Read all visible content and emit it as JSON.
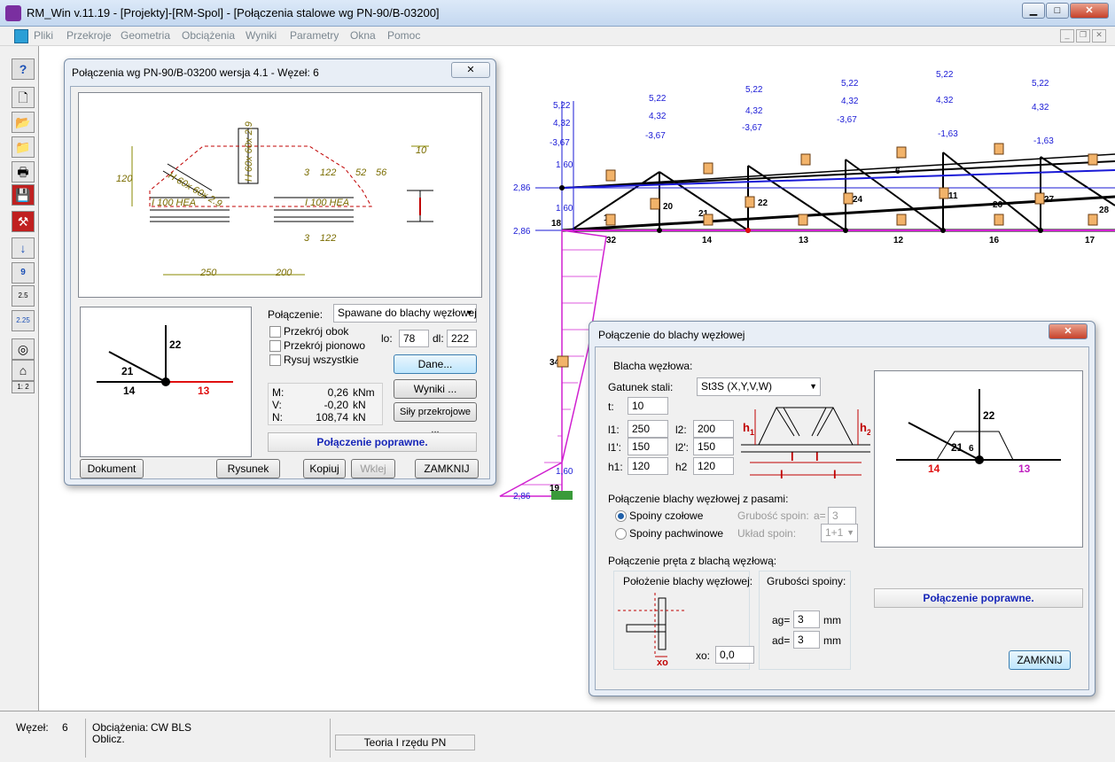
{
  "app": {
    "title": "RM_Win v.11.19 - [Projekty]-[RM-Spol] - [Połączenia stalowe wg PN-90/B-03200]"
  },
  "menu": [
    "Pliki",
    "Przekroje",
    "Geometria",
    "Obciążenia",
    "Wyniki",
    "Parametry",
    "Okna",
    "Pomoc"
  ],
  "toolbar": {
    "label_9": "9",
    "label_25": "2.5",
    "label_225": "2.25",
    "label_scale": "1: 2"
  },
  "dialog1": {
    "title": "Połączenia wg PN-90/B-03200 wersja 4.1 - Węzeł: 6",
    "drawing": {
      "dim_120": "120",
      "dim_10": "10",
      "lbl_h": "H 60x 60x 2.9",
      "lbl_v": "H 60x 60x 2.9",
      "lbl_i1": "I 100 HEA",
      "lbl_i2": "I 100 HEA",
      "w122a": "122",
      "w3a": "3",
      "w56": "56",
      "w52": "52",
      "w122b": "122",
      "w3b": "3",
      "dim250": "250",
      "dim200": "200"
    },
    "node": {
      "n22": "22",
      "n21": "21",
      "n14": "14",
      "n13": "13"
    },
    "polaczenie_label": "Połączenie:",
    "polaczenie_value": "Spawane do blachy węzłowej",
    "cb_obok": "Przekrój obok",
    "cb_pion": "Przekrój pionowo",
    "cb_all": "Rysuj wszystkie",
    "lo_label": "lo:",
    "lo_value": "78",
    "dl_label": "dl:",
    "dl_value": "222",
    "btn_dane": "Dane...",
    "btn_wyniki": "Wyniki ...",
    "btn_sily": "Siły przekrojowe ...",
    "forces": [
      {
        "k": "M:",
        "v": "0,26",
        "u": "kNm"
      },
      {
        "k": "V:",
        "v": "-0,20",
        "u": "kN"
      },
      {
        "k": "N:",
        "v": "108,74",
        "u": "kN"
      }
    ],
    "status": "Połączenie poprawne.",
    "btn_dok": "Dokument",
    "btn_rys": "Rysunek",
    "btn_kop": "Kopiuj",
    "btn_wklej": "Wklej",
    "btn_zam": "ZAMKNIJ"
  },
  "dialog2": {
    "title": "Połączenie do blachy węzłowej",
    "g1": "Blacha węzłowa:",
    "gatunek_label": "Gatunek stali:",
    "gatunek_value": "St3S (X,Y,V,W)",
    "t_label": "t:",
    "t_value": "10",
    "l1_label": "l1:",
    "l1_value": "250",
    "l2_label": "l2:",
    "l2_value": "200",
    "l1p_label": "l1':",
    "l1p_value": "150",
    "l2p_label": "l2':",
    "l2p_value": "150",
    "h1_label": "h1:",
    "h1_value": "120",
    "h2_label": "h2",
    "h2_value": "120",
    "sk_h1": "h",
    "sk_h2": "h",
    "sk_1": "1",
    "sk_2": "2",
    "sk_l1": "l",
    "sk_l2": "l",
    "g2": "Połączenie blachy węzłowej z pasami:",
    "r1": "Spoiny czołowe",
    "r2": "Spoiny pachwinowe",
    "gr_label": "Grubość spoin:",
    "a_label": "a=",
    "a_value": "3",
    "uklad_label": "Układ spoin:",
    "uklad_value": "1+1",
    "g3": "Połączenie pręta z blachą węzłową:",
    "g3a": "Położenie blachy węzłowej:",
    "g3b": "Grubości spoiny:",
    "xo_label": "xo:",
    "xo_value": "0,0",
    "xo_sk": "xo",
    "ag_label": "ag=",
    "ag_value": "3",
    "ad_label": "ad=",
    "ad_value": "3",
    "mm": "mm",
    "node": {
      "n22": "22",
      "n21": "21",
      "n6": "6",
      "n14": "14",
      "n13": "13"
    },
    "status": "Połączenie poprawne.",
    "btn_zam": "ZAMKNIJ"
  },
  "statusbar": {
    "wezel_label": "Węzeł:",
    "wezel_value": "6",
    "obc_label": "Obciążenia:",
    "obc_value": "CW BLS",
    "oblicz": "Oblicz.",
    "teoria": "Teoria I rzędu PN"
  },
  "truss": {
    "loads_top": [
      "5,22",
      "5,22",
      "5,22",
      "5,22",
      "5,22",
      "5,22"
    ],
    "loads_mid": [
      "4,32",
      "4,32",
      "4,32",
      "4,32",
      "4,32",
      "4,32"
    ],
    "loads_low": [
      "-3,67",
      "-3,67",
      "-3,67",
      "-3,67",
      "-1,63",
      "-1,63"
    ],
    "node_nums": [
      "18",
      "32",
      "14",
      "13",
      "12",
      "16",
      "17",
      "20",
      "22",
      "24",
      "11",
      "27",
      "28",
      "21",
      "26",
      "6",
      "15",
      "19"
    ],
    "left_vals": [
      "2,86",
      "2,86",
      "2,86",
      "1,60",
      "1,60",
      "1,60"
    ],
    "support": "34,9"
  }
}
